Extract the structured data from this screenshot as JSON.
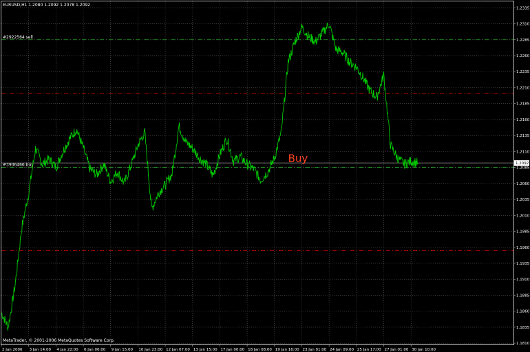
{
  "chart_data": {
    "type": "line",
    "title": "EURUSD,H1  1.2080 1.2092 1.2078 1.2092",
    "symbol": "EURUSD,H1",
    "ohlc": [
      1.208,
      1.2092,
      1.2078,
      1.2092
    ],
    "ylim": [
      1.1808,
      1.2345
    ],
    "y_ticks": [
      1.2335,
      1.231,
      1.2285,
      1.226,
      1.2235,
      1.221,
      1.2185,
      1.216,
      1.2135,
      1.211,
      1.2085,
      1.206,
      1.2035,
      1.201,
      1.1985,
      1.196,
      1.1935,
      1.191,
      1.1885,
      1.186,
      1.1835,
      1.181
    ],
    "y_tick_labels": [
      "1.2335",
      "1.2310",
      "1.2285",
      "1.2260",
      "1.2235",
      "1.2210",
      "1.2185",
      "1.2160",
      "1.2135",
      "1.2110",
      "1.2085",
      "1.2060",
      "1.2035",
      "1.2010",
      "1.1985",
      "1.1960",
      "1.1935",
      "1.1910",
      "1.1885",
      "1.1860",
      "1.1835",
      "1.1810"
    ],
    "x_tick_labels": [
      "2 Jan 2006",
      "3 Jan 14:00",
      "4 Jan 22:00",
      "6 Jan 06:00",
      "9 Jan 15:00",
      "10 Jan 23:00",
      "12 Jan 07:00",
      "13 Jan 15:00",
      "17 Jan 00:00",
      "18 Jan 08:00",
      "19 Jan 16:00",
      "23 Jan 01:00",
      "24 Jan 09:00",
      "25 Jan 17:00",
      "27 Jan 01:00",
      "30 Jan 10:00"
    ],
    "x_max": 150,
    "x_tick_positions": [
      0,
      8,
      16,
      24,
      32,
      40,
      48,
      56,
      64,
      72,
      80,
      88,
      96,
      104,
      112,
      120
    ],
    "grid": true,
    "current_price": 1.2092,
    "current_price_label": "1.2092",
    "horizontal_lines": [
      {
        "label": "#2922564 sell",
        "price": 1.2285,
        "color": "#22aa22",
        "style": "dash-dot"
      },
      {
        "label": "",
        "price": 1.2201,
        "color": "#cc0000",
        "style": "dash-dot"
      },
      {
        "label": "#3906466 buy",
        "price": 1.2085,
        "color": "#22aa22",
        "style": "dash-dot"
      },
      {
        "label": "",
        "price": 1.1955,
        "color": "#cc0000",
        "style": "dash-dot"
      }
    ],
    "annotation": {
      "text": "Buy",
      "x": 84,
      "price": 1.2098,
      "color": "#ff4422"
    },
    "series": [
      {
        "color": "#00cc00",
        "x": [
          0,
          2,
          4,
          6,
          8,
          10,
          12,
          14,
          16,
          18,
          20,
          22,
          24,
          26,
          28,
          30,
          32,
          34,
          36,
          38,
          40,
          42,
          44,
          46,
          48,
          50,
          52,
          54,
          56,
          58,
          60,
          62,
          64,
          66,
          68,
          70,
          72,
          74,
          76,
          78,
          80,
          82,
          84,
          86,
          88,
          90,
          92,
          94,
          96,
          98,
          100,
          102,
          104,
          106,
          108,
          110,
          112,
          114,
          116,
          118,
          120,
          122
        ],
        "values": [
          1.1858,
          1.1835,
          1.19,
          1.1992,
          1.2045,
          1.2115,
          1.209,
          1.2098,
          1.2085,
          1.211,
          1.213,
          1.2145,
          1.2115,
          1.2082,
          1.2074,
          1.209,
          1.2063,
          1.2078,
          1.206,
          1.2088,
          1.212,
          1.214,
          1.202,
          1.2045,
          1.2058,
          1.2075,
          1.215,
          1.2125,
          1.2115,
          1.21,
          1.209,
          1.2072,
          1.2105,
          1.213,
          1.2095,
          1.2102,
          1.209,
          1.2082,
          1.2065,
          1.2078,
          1.21,
          1.214,
          1.225,
          1.2282,
          1.2305,
          1.229,
          1.2282,
          1.2295,
          1.231,
          1.227,
          1.2265,
          1.225,
          1.2242,
          1.2225,
          1.2205,
          1.2195,
          1.223,
          1.212,
          1.21,
          1.209,
          1.2095,
          1.2092
        ]
      }
    ],
    "copyright": "MetaTrader, © 2001-2006 MetaQuotes Software Corp."
  }
}
